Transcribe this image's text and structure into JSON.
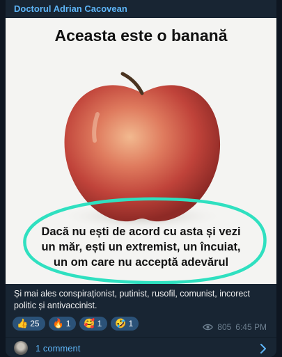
{
  "post": {
    "author": "Doctorul Adrian Cacovean",
    "image": {
      "headline": "Aceasta este o banană",
      "caption_lines": [
        "Dacă nu ești de acord cu asta și vezi",
        "un măr, ești un extremist, un încuiat,",
        "un om care nu acceptă adevărul"
      ]
    },
    "text": "Și mai ales conspiraționist, putinist, rusofil, comunist, incorect politic și antivaccinist.",
    "reactions": [
      {
        "emoji": "👍",
        "count": "25"
      },
      {
        "emoji": "🔥",
        "count": "1"
      },
      {
        "emoji": "🥰",
        "count": "1"
      },
      {
        "emoji": "🤣",
        "count": "1"
      }
    ],
    "views": "805",
    "time": "6:45 PM",
    "comments_label": "1 comment"
  },
  "colors": {
    "background": "#0e1621",
    "bubble": "#182533",
    "accent": "#5eb5f7",
    "reaction_bg": "#2b5278",
    "highlight_circle": "#2fe0c0"
  },
  "icons": [
    "eye-icon",
    "chevron-right-icon"
  ]
}
